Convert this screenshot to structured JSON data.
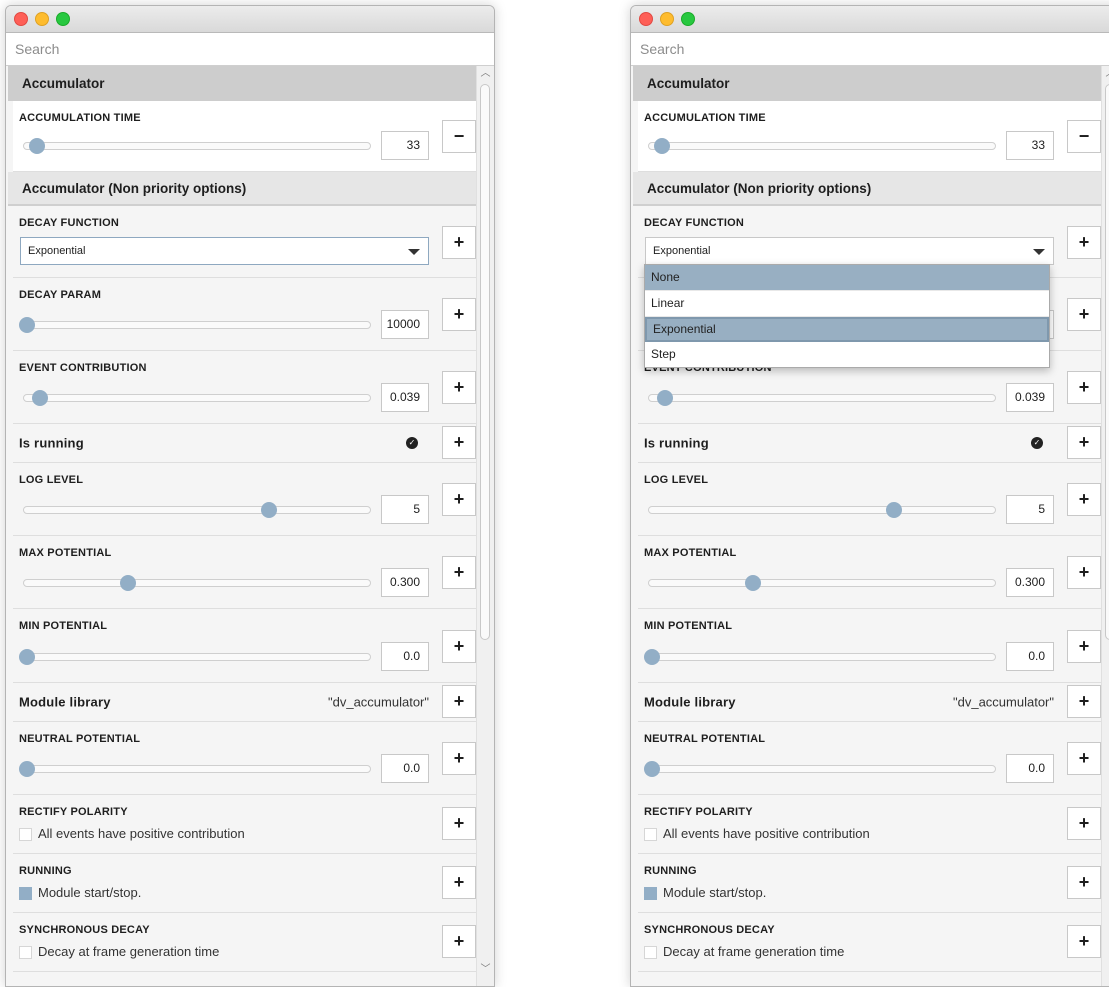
{
  "search": {
    "placeholder": "Search"
  },
  "groups": {
    "main": "Accumulator",
    "non_priority": "Accumulator (Non priority options)"
  },
  "icons": {
    "minus": "minus-icon",
    "plus": "plus-icon",
    "check": "check-circle-icon",
    "caret": "caret-down-icon"
  },
  "colors": {
    "knob": "#92aec6",
    "menu_highlight": "#98afc2"
  },
  "buttons": {
    "minus": "−",
    "plus": "+"
  },
  "accumulation_time": {
    "label": "ACCUMULATION TIME",
    "value": "33",
    "position": 0.04
  },
  "decay_function": {
    "label": "DECAY FUNCTION",
    "value": "Exponential",
    "options": [
      "None",
      "Linear",
      "Exponential",
      "Step"
    ]
  },
  "decay_param": {
    "label": "DECAY PARAM",
    "value": "10000",
    "position": 0.0
  },
  "event_contribution": {
    "label": "EVENT CONTRIBUTION",
    "value": "0.039",
    "position": 0.05
  },
  "is_running": {
    "label": "Is running",
    "checked": true
  },
  "log_level": {
    "label": "LOG LEVEL",
    "value": "5",
    "position": 0.71
  },
  "max_potential": {
    "label": "MAX POTENTIAL",
    "value": "0.300",
    "position": 0.3
  },
  "min_potential": {
    "label": "MIN POTENTIAL",
    "value": "0.0",
    "position": 0.0
  },
  "module_library": {
    "label": "Module library",
    "value": "\"dv_accumulator\""
  },
  "neutral_potential": {
    "label": "NEUTRAL POTENTIAL",
    "value": "0.0",
    "position": 0.0
  },
  "rectify_polarity": {
    "label": "RECTIFY POLARITY",
    "checkbox_label": "All events have positive contribution",
    "checked": false
  },
  "running": {
    "label": "RUNNING",
    "checkbox_label": "Module start/stop.",
    "checked": true
  },
  "synchronous_decay": {
    "label": "SYNCHRONOUS DECAY",
    "checkbox_label": "Decay at frame generation time",
    "checked": false
  },
  "dropdown_menu": {
    "items": [
      "None",
      "Linear",
      "Exponential",
      "Step"
    ],
    "highlighted": "None",
    "selected": "Exponential"
  }
}
